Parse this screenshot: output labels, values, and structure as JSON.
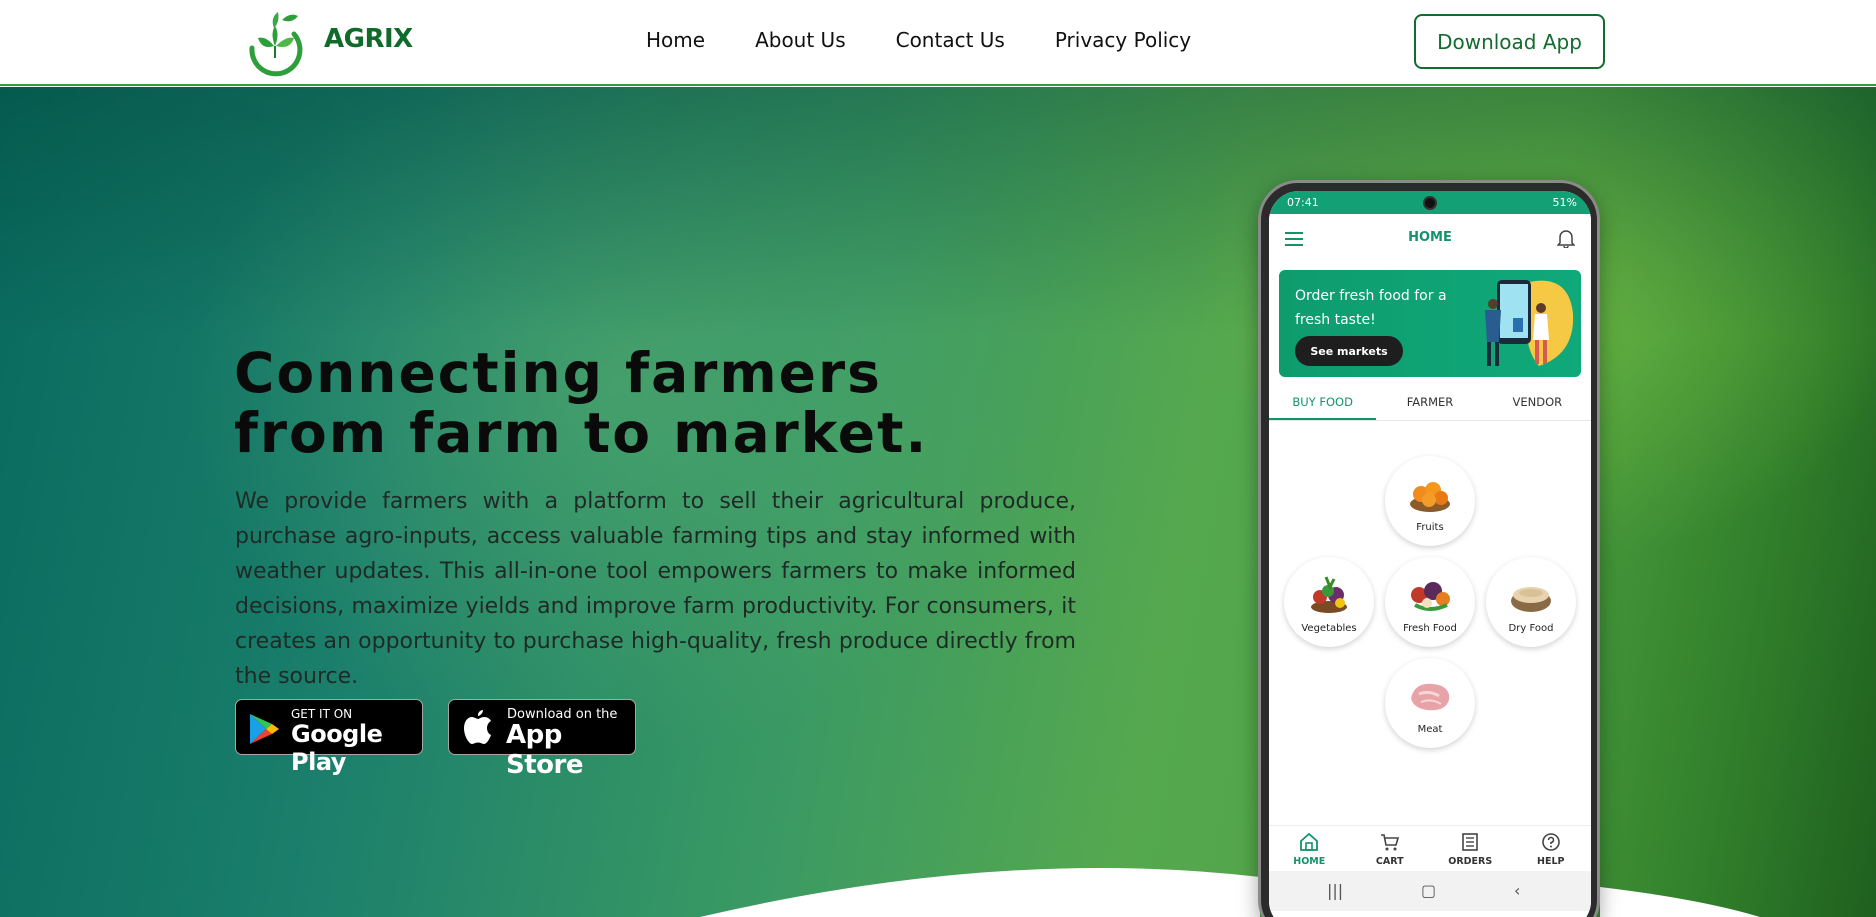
{
  "nav": {
    "brand": "AGRIX",
    "links": [
      "Home",
      "About Us",
      "Contact Us",
      "Privacy Policy"
    ],
    "download_label": "Download App"
  },
  "hero": {
    "headline_line1": "Connecting farmers",
    "headline_line2": "from farm to market.",
    "description": "We provide farmers with a platform to sell their agricultural produce, purchase agro-inputs, access valuable farming tips and stay informed with weather updates. This all-in-one tool empowers farmers to make informed decisions, maximize yields and improve farm productivity. For consumers, it creates an opportunity to purchase high-quality, fresh produce directly from the source."
  },
  "stores": {
    "google_small": "GET IT ON",
    "google_big": "Google Play",
    "apple_small": "Download on the",
    "apple_big": "App Store"
  },
  "phone": {
    "status_time": "07:41",
    "status_battery": "51%",
    "app_title": "HOME",
    "banner_text": "Order fresh food for a fresh taste!",
    "banner_button": "See markets",
    "tabs": [
      "BUY FOOD",
      "FARMER",
      "VENDOR"
    ],
    "categories": [
      "Fruits",
      "Vegetables",
      "Fresh Food",
      "Dry Food",
      "Meat"
    ],
    "bottom_nav": [
      "HOME",
      "CART",
      "ORDERS",
      "HELP"
    ]
  },
  "colors": {
    "brand_green": "#126b2f",
    "app_accent": "#13936a",
    "nav_border": "#2e9e3b"
  },
  "icons": [
    "leaf-logo-icon",
    "google-play-icon",
    "apple-icon",
    "hamburger-icon",
    "bell-icon",
    "home-icon",
    "cart-icon",
    "orders-icon",
    "help-icon"
  ]
}
